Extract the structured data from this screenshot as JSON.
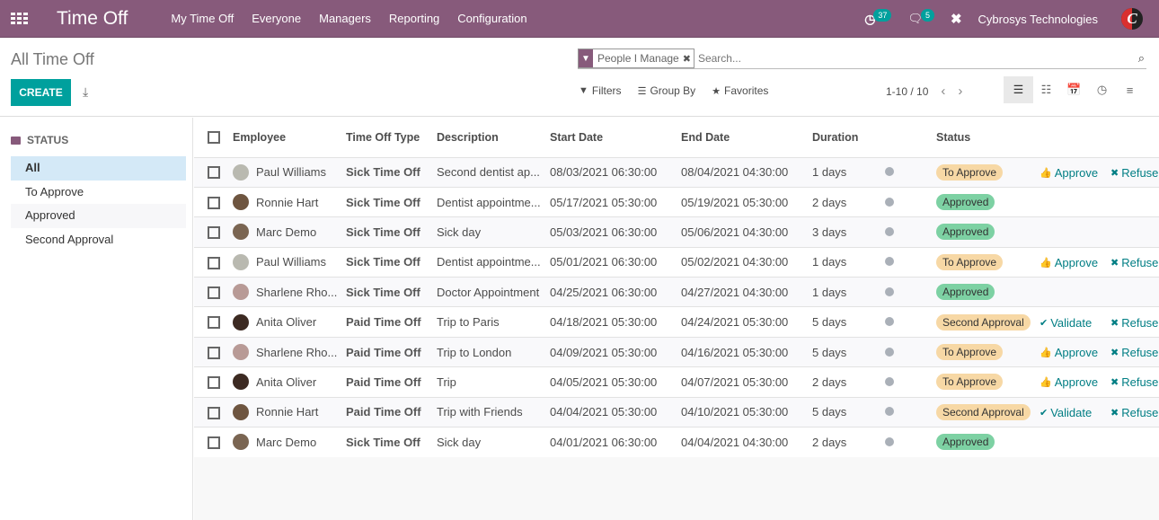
{
  "nav": {
    "app_title": "Time Off",
    "menus": [
      "My Time Off",
      "Everyone",
      "Managers",
      "Reporting",
      "Configuration"
    ],
    "activity_count": "37",
    "messages_count": "5",
    "company": "Cybrosys Technologies",
    "avatar_letter": "C"
  },
  "control_panel": {
    "title": "All Time Off",
    "create_label": "CREATE",
    "facet_label": "People I Manage",
    "search_placeholder": "Search...",
    "filters_label": "Filters",
    "groupby_label": "Group By",
    "favorites_label": "Favorites",
    "pager": "1-10 / 10"
  },
  "sidebar": {
    "heading": "STATUS",
    "items": [
      "All",
      "To Approve",
      "Approved",
      "Second Approval"
    ],
    "active": "All"
  },
  "table": {
    "columns": [
      "Employee",
      "Time Off Type",
      "Description",
      "Start Date",
      "End Date",
      "Duration",
      "",
      "Status"
    ],
    "rows": [
      {
        "employee": "Paul Williams",
        "type": "Sick Time Off",
        "description": "Second dentist ap...",
        "start": "08/03/2021 06:30:00",
        "end": "08/04/2021 04:30:00",
        "duration": "1 days",
        "status": "To Approve",
        "action": "Approve",
        "refuse": "Refuse"
      },
      {
        "employee": "Ronnie Hart",
        "type": "Sick Time Off",
        "description": "Dentist appointme...",
        "start": "05/17/2021 05:30:00",
        "end": "05/19/2021 05:30:00",
        "duration": "2 days",
        "status": "Approved",
        "action": "",
        "refuse": ""
      },
      {
        "employee": "Marc Demo",
        "type": "Sick Time Off",
        "description": "Sick day",
        "start": "05/03/2021 06:30:00",
        "end": "05/06/2021 04:30:00",
        "duration": "3 days",
        "status": "Approved",
        "action": "",
        "refuse": ""
      },
      {
        "employee": "Paul Williams",
        "type": "Sick Time Off",
        "description": "Dentist appointme...",
        "start": "05/01/2021 06:30:00",
        "end": "05/02/2021 04:30:00",
        "duration": "1 days",
        "status": "To Approve",
        "action": "Approve",
        "refuse": "Refuse"
      },
      {
        "employee": "Sharlene Rho...",
        "type": "Sick Time Off",
        "description": "Doctor Appointment",
        "start": "04/25/2021 06:30:00",
        "end": "04/27/2021 04:30:00",
        "duration": "1 days",
        "status": "Approved",
        "action": "",
        "refuse": ""
      },
      {
        "employee": "Anita Oliver",
        "type": "Paid Time Off",
        "description": "Trip to Paris",
        "start": "04/18/2021 05:30:00",
        "end": "04/24/2021 05:30:00",
        "duration": "5 days",
        "status": "Second Approval",
        "action": "Validate",
        "refuse": "Refuse"
      },
      {
        "employee": "Sharlene Rho...",
        "type": "Paid Time Off",
        "description": "Trip to London",
        "start": "04/09/2021 05:30:00",
        "end": "04/16/2021 05:30:00",
        "duration": "5 days",
        "status": "To Approve",
        "action": "Approve",
        "refuse": "Refuse"
      },
      {
        "employee": "Anita Oliver",
        "type": "Paid Time Off",
        "description": "Trip",
        "start": "04/05/2021 05:30:00",
        "end": "04/07/2021 05:30:00",
        "duration": "2 days",
        "status": "To Approve",
        "action": "Approve",
        "refuse": "Refuse"
      },
      {
        "employee": "Ronnie Hart",
        "type": "Paid Time Off",
        "description": "Trip with Friends",
        "start": "04/04/2021 05:30:00",
        "end": "04/10/2021 05:30:00",
        "duration": "5 days",
        "status": "Second Approval",
        "action": "Validate",
        "refuse": "Refuse"
      },
      {
        "employee": "Marc Demo",
        "type": "Sick Time Off",
        "description": "Sick day",
        "start": "04/01/2021 06:30:00",
        "end": "04/04/2021 04:30:00",
        "duration": "2 days",
        "status": "Approved",
        "action": "",
        "refuse": ""
      }
    ]
  },
  "colors": {
    "brand": "#875a7b",
    "primary": "#00a09d",
    "link": "#017e84",
    "to_approve": "#f7d8a5",
    "approved": "#7dd1a3"
  },
  "icons": {
    "apps": "apps-grid-icon",
    "activity": "clock-activity-icon",
    "messages": "chat-icon",
    "debug": "tools-icon",
    "download": "download-icon",
    "filter": "filter-icon",
    "groupby": "list-lines-icon",
    "favorites": "star-icon",
    "search": "search-icon"
  }
}
